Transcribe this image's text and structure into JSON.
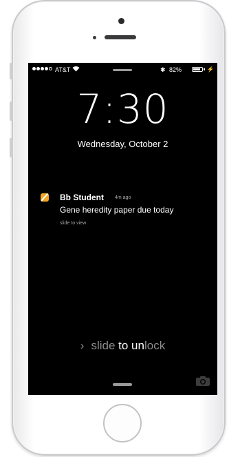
{
  "status_bar": {
    "carrier": "AT&T",
    "bluetooth": "✱",
    "battery_percent": "82%",
    "battery_level": 0.82,
    "charging": "⚡",
    "icons": [
      "signal-dots-icon",
      "wifi-icon",
      "bluetooth-icon",
      "battery-icon",
      "charging-icon"
    ]
  },
  "lock_screen": {
    "time": "7:30",
    "date": "Wednesday, October 2",
    "slide_chevron": "›",
    "slide_text_prefix": "slide ",
    "slide_text_highlight": "to un",
    "slide_text_suffix": "lock"
  },
  "notification": {
    "app_name": "Bb Student",
    "time_ago": "4m ago",
    "message": "Gene heredity paper due today",
    "hint": "slide to view",
    "icon": "bb-student-app-icon",
    "icon_color": "#f3a521"
  },
  "colors": {
    "screen_background": "#000000",
    "muted_text": "#a8a8a8"
  }
}
